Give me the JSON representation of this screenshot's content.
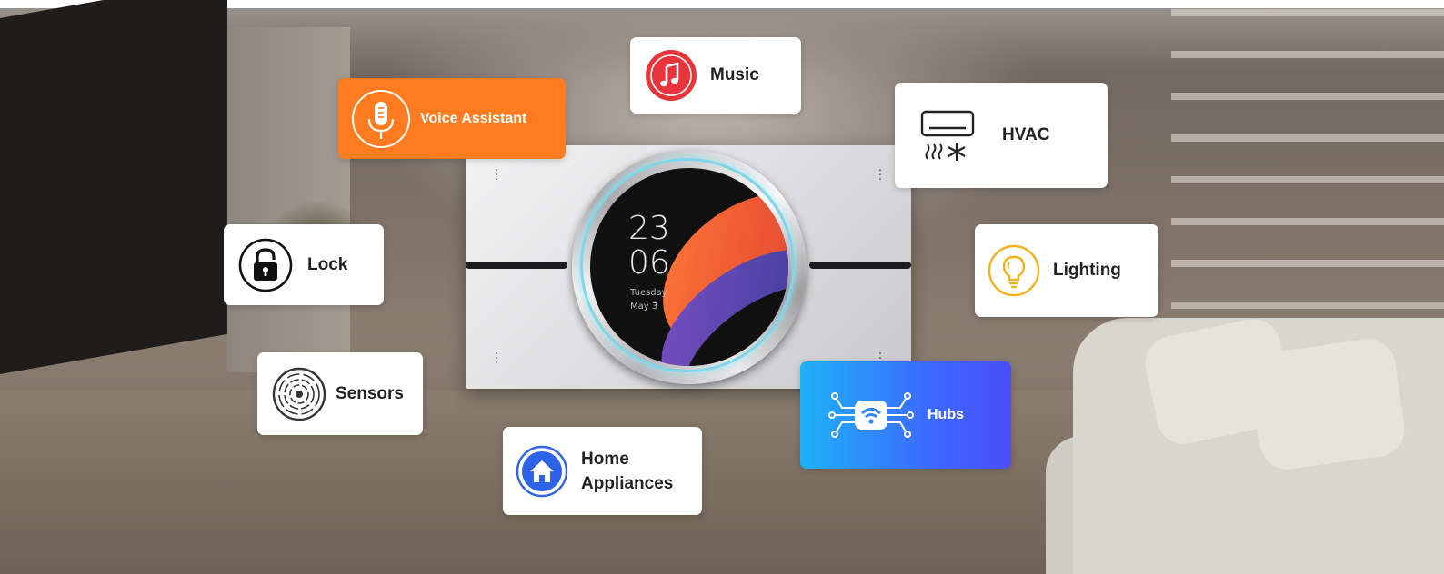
{
  "panel": {
    "clock_hour": "23",
    "clock_minute": "06",
    "day": "Tuesday",
    "date": "May 3"
  },
  "features": {
    "voice_assistant": "Voice Assistant",
    "music": "Music",
    "hvac": "HVAC",
    "lock": "Lock",
    "lighting": "Lighting",
    "sensors": "Sensors",
    "hubs": "Hubs",
    "home_appliances_line1": "Home",
    "home_appliances_line2": "Appliances"
  },
  "colors": {
    "voice_card": "#ff7b1f",
    "music_icon": "#e8353b",
    "lighting_icon": "#f2b21c",
    "home_icon": "#2d63e6",
    "hubs_gradient_start": "#1fb2f8",
    "hubs_gradient_end": "#4a4dfb",
    "panel_ring": "#7fd6e8"
  },
  "icons": {
    "voice_assistant": "microphone-icon",
    "music": "music-note-icon",
    "hvac": "air-conditioner-icon",
    "lock": "padlock-icon",
    "lighting": "lightbulb-icon",
    "sensors": "sensor-icon",
    "hubs": "wifi-hub-icon",
    "home_appliances": "house-icon"
  }
}
